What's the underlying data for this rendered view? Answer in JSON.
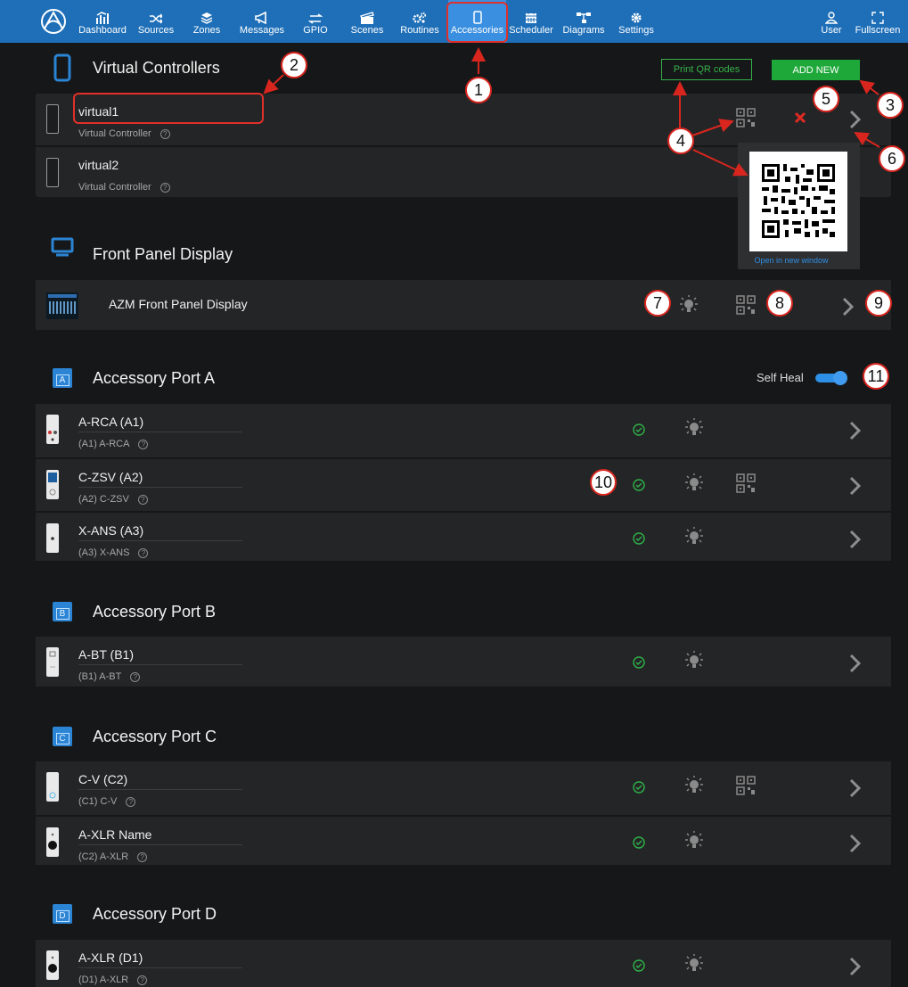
{
  "nav": {
    "items": [
      {
        "key": "dashboard",
        "label": "Dashboard",
        "icon": "dashboard-icon"
      },
      {
        "key": "sources",
        "label": "Sources",
        "icon": "shuffle-icon"
      },
      {
        "key": "zones",
        "label": "Zones",
        "icon": "layers-icon"
      },
      {
        "key": "messages",
        "label": "Messages",
        "icon": "megaphone-icon"
      },
      {
        "key": "gpio",
        "label": "GPIO",
        "icon": "gpio-arrows-icon"
      },
      {
        "key": "scenes",
        "label": "Scenes",
        "icon": "clapperboard-icon"
      },
      {
        "key": "routines",
        "label": "Routines",
        "icon": "gears-icon"
      },
      {
        "key": "accessories",
        "label": "Accessories",
        "icon": "tablet-icon"
      },
      {
        "key": "scheduler",
        "label": "Scheduler",
        "icon": "calendar-icon"
      },
      {
        "key": "diagrams",
        "label": "Diagrams",
        "icon": "diagram-icon"
      },
      {
        "key": "settings",
        "label": "Settings",
        "icon": "gear-icon"
      }
    ],
    "active": "Accessories",
    "user_label": "User",
    "fullscreen_label": "Fullscreen"
  },
  "virtual": {
    "title": "Virtual Controllers",
    "print_qr_label": "Print QR codes",
    "add_new_label": "ADD NEW",
    "devices": [
      {
        "name": "virtual1",
        "type": "Virtual Controller"
      },
      {
        "name": "virtual2",
        "type": "Virtual Controller"
      }
    ],
    "qr_popup": {
      "link_label": "Open in new window"
    }
  },
  "front_panel": {
    "title": "Front Panel Display",
    "device_name": "AZM Front Panel Display"
  },
  "ports": [
    {
      "title": "Accessory Port A",
      "letter": "A",
      "self_heal_label": "Self Heal",
      "self_heal_on": true,
      "devices": [
        {
          "name": "A-RCA (A1)",
          "sub": "(A1) A-RCA"
        },
        {
          "name": "C-ZSV (A2)",
          "sub": "(A2) C-ZSV"
        },
        {
          "name": "X-ANS (A3)",
          "sub": "(A3) X-ANS"
        }
      ]
    },
    {
      "title": "Accessory Port B",
      "letter": "B",
      "devices": [
        {
          "name": "A-BT (B1)",
          "sub": "(B1) A-BT"
        }
      ]
    },
    {
      "title": "Accessory Port C",
      "letter": "C",
      "devices": [
        {
          "name": "C-V (C2)",
          "sub": "(C1) C-V"
        },
        {
          "name": "A-XLR Name",
          "sub": "(C2) A-XLR"
        }
      ]
    },
    {
      "title": "Accessory Port D",
      "letter": "D",
      "devices": [
        {
          "name": "A-XLR (D1)",
          "sub": "(D1) A-XLR"
        }
      ]
    }
  ],
  "callouts": [
    "1",
    "2",
    "3",
    "4",
    "5",
    "6",
    "7",
    "8",
    "9",
    "10",
    "11"
  ],
  "colors": {
    "nav_bg": "#1e6fb8",
    "accent_blue": "#2b84d4",
    "green": "#1fa83a",
    "callout_red": "#d8261f",
    "page_bg": "#161718",
    "card_bg": "#242526"
  }
}
